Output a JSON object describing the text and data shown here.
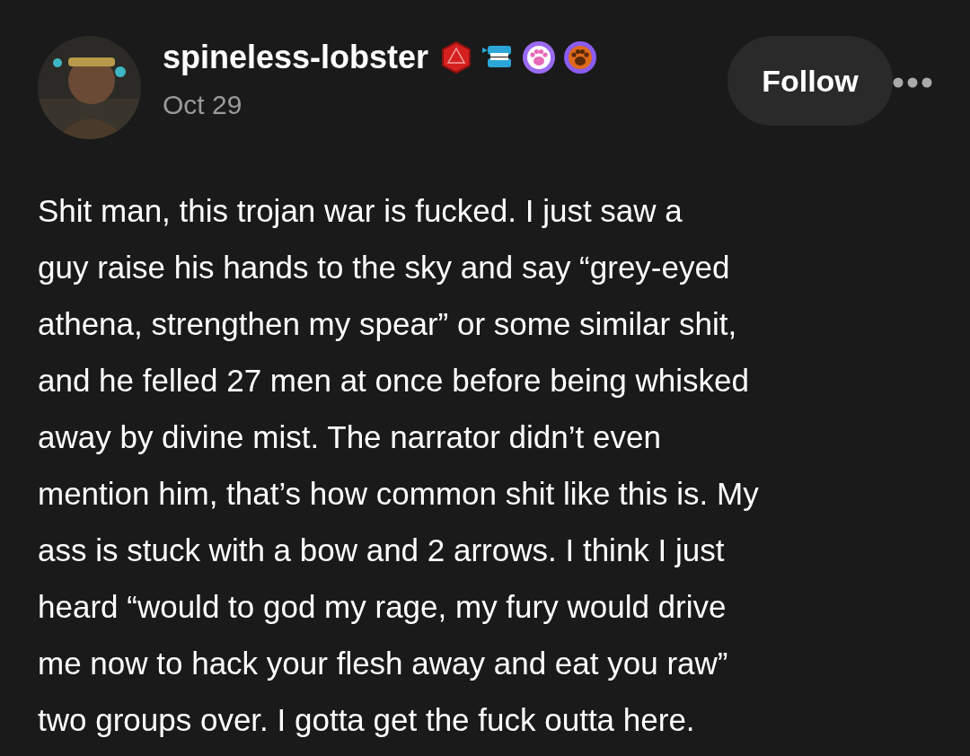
{
  "post": {
    "author": "spineless-lobster",
    "badges": [
      {
        "kind": "d20"
      },
      {
        "kind": "teeth"
      },
      {
        "kind": "paw",
        "color": "#9b6bf2"
      },
      {
        "kind": "paw",
        "color": "#8a5cf0"
      }
    ],
    "date": "Oct 29",
    "follow_button": "Follow",
    "body": "Shit man, this trojan war is fucked. I just saw a\nguy raise his hands to the sky and say “grey-eyed\nathena, strengthen my spear” or some similar shit,\nand he felled 27 men at once before being whisked\naway by divine mist. The narrator didn’t even\nmention him, that’s how common shit like this is. My\nass is stuck with a bow and 2 arrows. I think I just\nheard “would to god my rage, my fury would drive\nme now to hack your flesh away and eat you raw”\ntwo groups over. I gotta get the fuck outta here."
  }
}
